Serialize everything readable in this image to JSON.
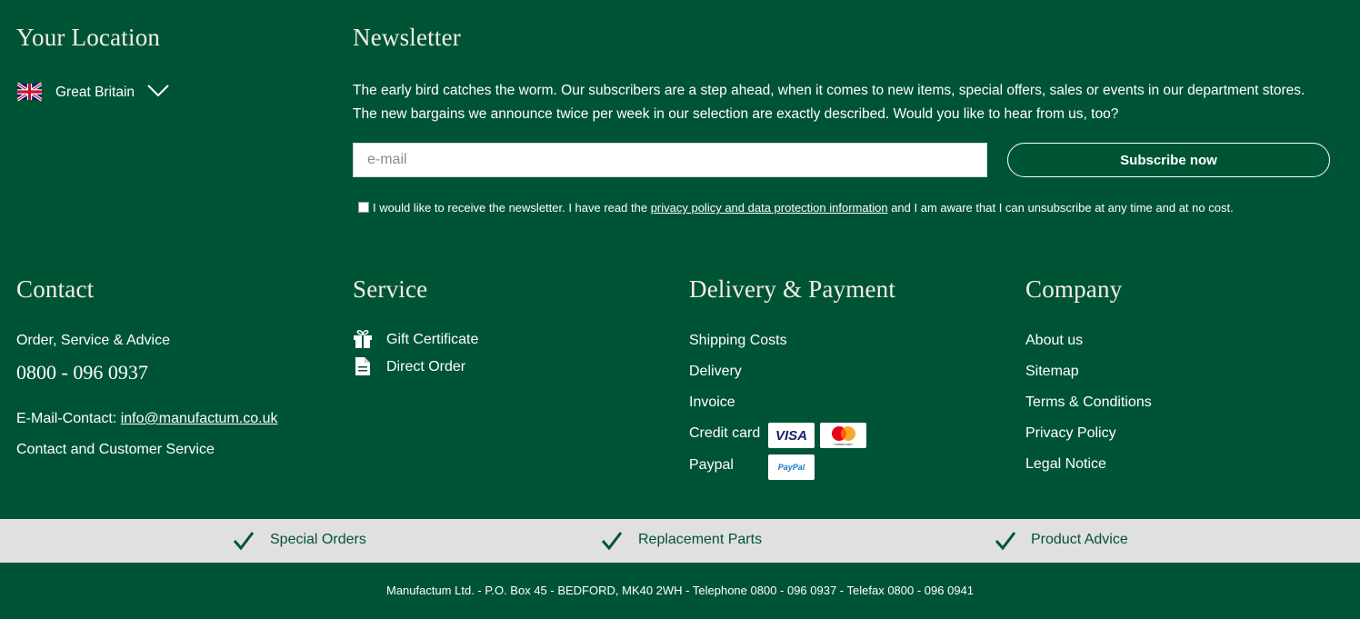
{
  "location": {
    "heading": "Your Location",
    "country": "Great Britain",
    "flag_icon": "uk-flag-icon",
    "dropdown_icon": "chevron-down-icon"
  },
  "newsletter": {
    "heading": "Newsletter",
    "text_line1": "The early bird catches the worm. Our subscribers are a step ahead, when it comes to new items, special offers, sales or events in our department stores.",
    "text_line2": "The new bargains we announce twice per week in our selection are exactly described. Would you like to hear from us, too?",
    "email_placeholder": "e-mail",
    "email_value": "",
    "subscribe_label": "Subscribe now",
    "consent_before": "I would like to receive the newsletter. I have read the",
    "consent_link": "privacy policy and data protection information",
    "consent_after": "and I am aware that I can unsubscribe at any time and at no cost."
  },
  "contact": {
    "heading": "Contact",
    "order_label": "Order, Service & Advice",
    "phone": "0800 - 096 0937",
    "email_label": "E-Mail-Contact:",
    "email": "info@manufactum.co.uk",
    "customer_service": "Contact and Customer Service"
  },
  "service": {
    "heading": "Service",
    "items": [
      {
        "label": "Gift Certificate",
        "icon": "gift-icon"
      },
      {
        "label": "Direct Order",
        "icon": "document-icon"
      }
    ]
  },
  "delivery": {
    "heading": "Delivery & Payment",
    "items": [
      "Shipping Costs",
      "Delivery",
      "Invoice",
      "Credit card",
      "Paypal"
    ],
    "logos": {
      "visa": "VISA",
      "mastercard": "mastercard",
      "paypal": "PayPal"
    }
  },
  "company": {
    "heading": "Company",
    "items": [
      "About us",
      "Sitemap",
      "Terms & Conditions",
      "Privacy Policy",
      "Legal Notice"
    ]
  },
  "benefits": [
    "Special Orders",
    "Replacement Parts",
    "Product Advice"
  ],
  "footer": {
    "address": "Manufactum Ltd. - P.O. Box 45 - BEDFORD, MK40 2WH - Telephone 0800 - 096 0937 - Telefax 0800 - 096 0941"
  },
  "colors": {
    "background": "#005436",
    "heading": "#f3efe4",
    "band": "#e0e0e0"
  }
}
